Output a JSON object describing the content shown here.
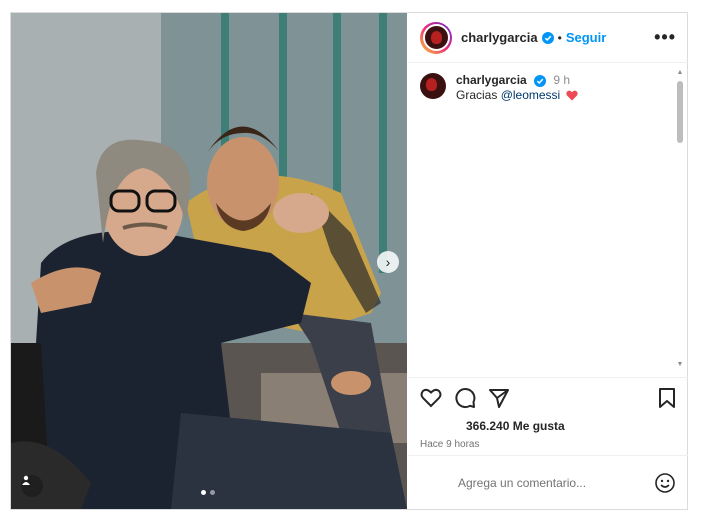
{
  "post": {
    "username": "charlygarcia",
    "separator": "•",
    "follow_label": "Seguir",
    "more_label": "•••",
    "caption": {
      "username": "charlygarcia",
      "time": "9 h",
      "text": "Gracias ",
      "mention": "@leomessi"
    },
    "likes": "366.240 Me gusta",
    "posted_ago": "Hace 9 horas",
    "comment_placeholder": "Agrega un comentario..."
  },
  "media": {
    "next_label": "›",
    "slide_count": 2,
    "active_slide": 0
  },
  "icons": {
    "verified": "verified-badge-icon",
    "heart": "red-heart-emoji-icon",
    "like": "heart-outline-icon",
    "comment": "speech-bubble-icon",
    "share": "paper-plane-icon",
    "save": "bookmark-icon",
    "emoji": "smiley-face-icon",
    "tag": "person-tag-icon"
  },
  "colors": {
    "accent": "#0095f6",
    "mention": "#00376b",
    "heart": "#ed4956",
    "muted": "#8e8e8e"
  }
}
